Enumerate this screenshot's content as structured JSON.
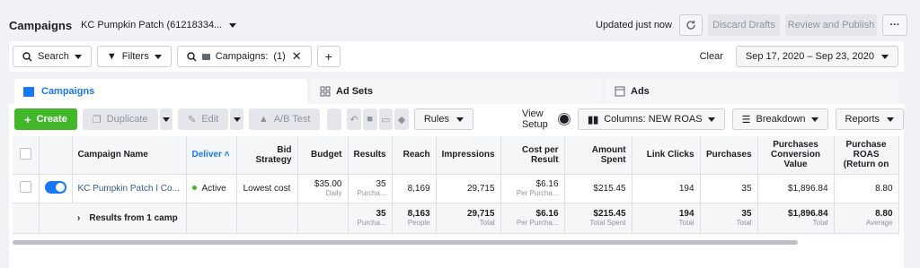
{
  "header": {
    "title": "Campaigns",
    "account": "KC Pumpkin Patch (61218334...",
    "updated": "Updated just now",
    "discard": "Discard Drafts",
    "review": "Review and Publish",
    "more": "···"
  },
  "search": {
    "search_label": "Search",
    "filters_label": "Filters",
    "chip_label": "Campaigns:",
    "chip_count": "(1)",
    "clear": "Clear",
    "date_range": "Sep 17, 2020 – Sep 23, 2020",
    "add": "+"
  },
  "tabs": {
    "campaigns": "Campaigns",
    "adsets": "Ad Sets",
    "ads": "Ads"
  },
  "toolbar": {
    "create": "Create",
    "duplicate": "Duplicate",
    "edit": "Edit",
    "ab_test": "A/B Test",
    "rules": "Rules",
    "view_setup": "View Setup",
    "columns": "Columns: NEW ROAS",
    "breakdown": "Breakdown",
    "reports": "Reports"
  },
  "table": {
    "headers": {
      "name": "Campaign Name",
      "delivery": "Deliver",
      "bid": "Bid Strategy",
      "budget": "Budget",
      "results": "Results",
      "reach": "Reach",
      "impressions": "Impressions",
      "cpr": "Cost per Result",
      "spent": "Amount Spent",
      "clicks": "Link Clicks",
      "purchases": "Purchases",
      "pcv": "Purchases Conversion Value",
      "roas": "Purchase ROAS (Return on"
    },
    "row": {
      "name": "KC Pumpkin Patch I Co...",
      "delivery": "Active",
      "bid": "Lowest cost",
      "budget": "$35.00",
      "budget_sub": "Daily",
      "results": "35",
      "results_sub": "Purcha...",
      "reach": "8,169",
      "impressions": "29,715",
      "cpr": "$6.16",
      "cpr_sub": "Per Purcha...",
      "spent": "$215.45",
      "clicks": "194",
      "purchases": "35",
      "pcv": "$1,896.84",
      "roas": "8.80"
    },
    "total": {
      "label": "Results from 1 camp",
      "results": "35",
      "results_sub": "Purcha...",
      "reach": "8,163",
      "reach_sub": "People",
      "impressions": "29,715",
      "impressions_sub": "Total",
      "cpr": "$6.16",
      "cpr_sub": "Per Purcha...",
      "spent": "$215.45",
      "spent_sub": "Total Spent",
      "clicks": "194",
      "clicks_sub": "Total",
      "purchases": "35",
      "purchases_sub": "Total",
      "pcv": "$1,896.84",
      "pcv_sub": "Total",
      "roas": "8.80",
      "roas_sub": "Average"
    }
  }
}
